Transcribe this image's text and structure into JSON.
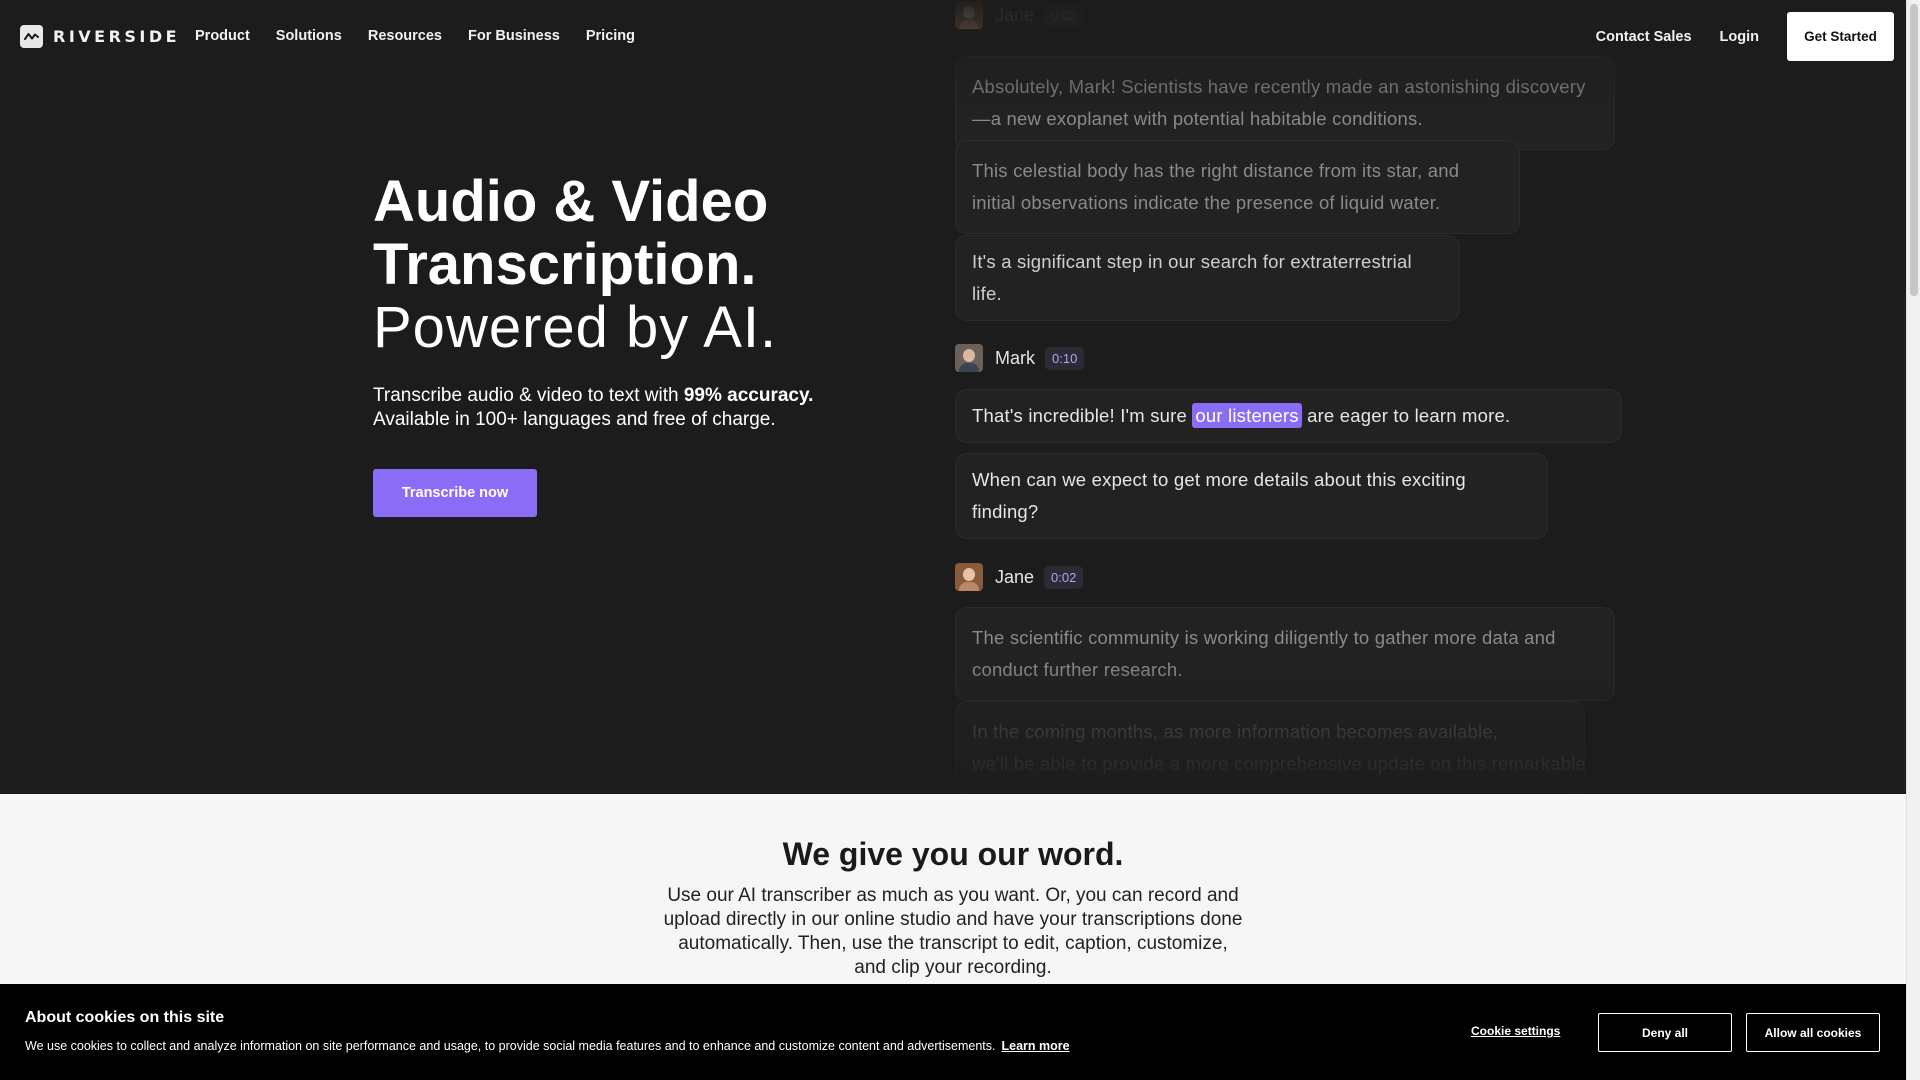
{
  "nav": {
    "logo_text": "RIVERSIDE",
    "links": [
      "Product",
      "Solutions",
      "Resources",
      "For Business",
      "Pricing"
    ],
    "contact_sales": "Contact Sales",
    "login": "Login",
    "get_started": "Get Started"
  },
  "hero": {
    "title_line1": "Audio & Video",
    "title_line2": "Transcription.",
    "title_line3": "Powered by AI.",
    "subtitle_prefix": "Transcribe audio & video to text with ",
    "subtitle_bold": "99% accuracy.",
    "subtitle_line2": "Available in 100+ languages and free of charge.",
    "cta": "Transcribe now"
  },
  "transcript": {
    "top_speaker": {
      "name": "Jane",
      "time": "0:02"
    },
    "top_bubbles": [
      "Absolutely, Mark! Scientists have recently made an astonishing discovery—a new exoplanet with potential habitable conditions.",
      "This celestial body has the right distance from its star, and initial observations indicate the presence of liquid water.",
      "It's a significant step in our search for extraterrestrial life."
    ],
    "mark": {
      "name": "Mark",
      "time": "0:10",
      "bubble1_before": "That's incredible! I'm sure ",
      "bubble1_highlight": "our listeners",
      "bubble1_after": " are eager to learn more.",
      "bubble2": "When can we expect to get more details about this exciting finding?"
    },
    "jane": {
      "name": "Jane",
      "time": "0:02",
      "bubble1": "The scientific community is working diligently to gather more data and conduct further research.",
      "bubble2_line1": "In the coming months, as more information becomes available,",
      "bubble2_line2": "we'll be able to provide a more comprehensive update on this remarkable"
    }
  },
  "word_section": {
    "title": "We give you our word.",
    "text": "Use our AI transcriber as much as you want. Or, you can record and upload directly in our online studio and have your transcriptions done automatically. Then, use the transcript to edit, caption, customize, and clip your recording."
  },
  "cookie": {
    "title": "About cookies on this site",
    "text": "We use cookies to collect and analyze information on site performance and usage, to provide social media features and to enhance and customize content and advertisements.",
    "learn_more": "Learn more",
    "settings": "Cookie settings",
    "deny": "Deny all",
    "allow": "Allow all cookies"
  },
  "colors": {
    "accent": "#8b6cf7",
    "hero_bg": "#1c1c1c",
    "section_bg": "#f6f6f6",
    "cookie_bg": "#000000"
  }
}
